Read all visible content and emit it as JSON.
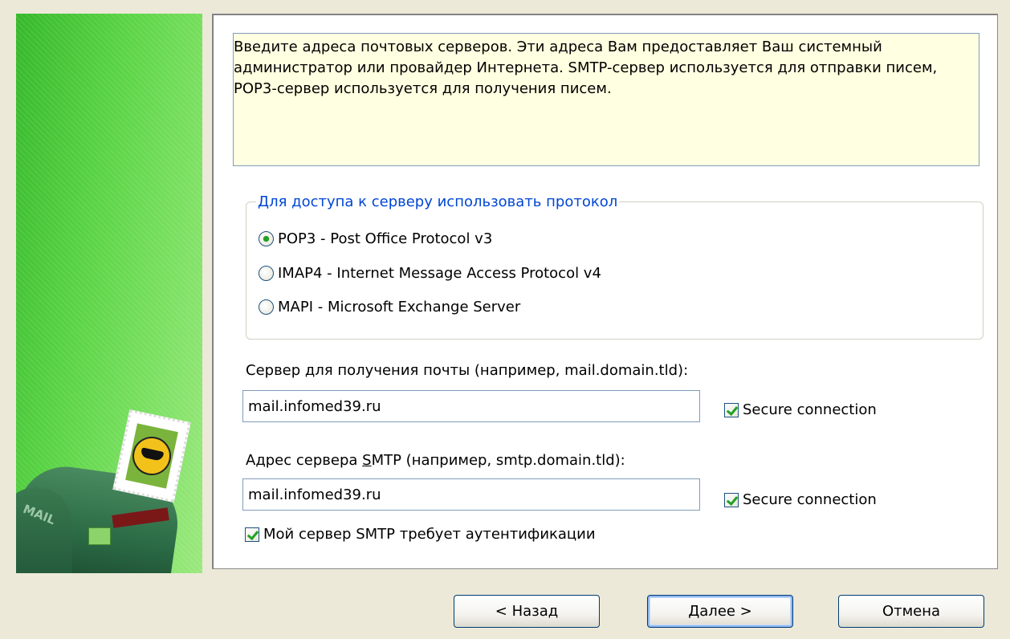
{
  "info_text": "Введите адреса почтовых серверов. Эти адреса Вам предоставляет Ваш системный\nадминистратор или провайдер Интернета. SMTP-сервер используется для отправки писем,\nPOP3-сервер используется для получения писем.",
  "side_art": {
    "mailbox_label": "MAIL"
  },
  "protocol_group": {
    "title": "Для доступа к серверу использовать протокол",
    "options": [
      {
        "label": "POP3 - Post Office Protocol v3",
        "checked": true
      },
      {
        "label": "IMAP4 - Internet Message Access Protocol v4",
        "checked": false
      },
      {
        "label": "MAPI - Microsoft Exchange Server",
        "checked": false
      }
    ]
  },
  "incoming": {
    "label": "Сервер для получения почты  (например, mail.domain.tld):",
    "value": "mail.infomed39.ru",
    "secure_label": "Secure connection",
    "secure_checked": true
  },
  "smtp": {
    "label": "Адрес сервера SMTP (например, smtp.domain.tld):",
    "value": "mail.infomed39.ru",
    "secure_label": "Secure connection",
    "secure_checked": true
  },
  "auth": {
    "label": "Мой сервер SMTP требует аутентификации",
    "checked": true
  },
  "buttons": {
    "back": "< Назад",
    "next": "Далее >",
    "cancel": "Отмена"
  },
  "colors": {
    "group_title": "#0046d5",
    "info_bg": "#ffffe1",
    "side_green": "#5ad445",
    "check_green": "#21a121"
  }
}
